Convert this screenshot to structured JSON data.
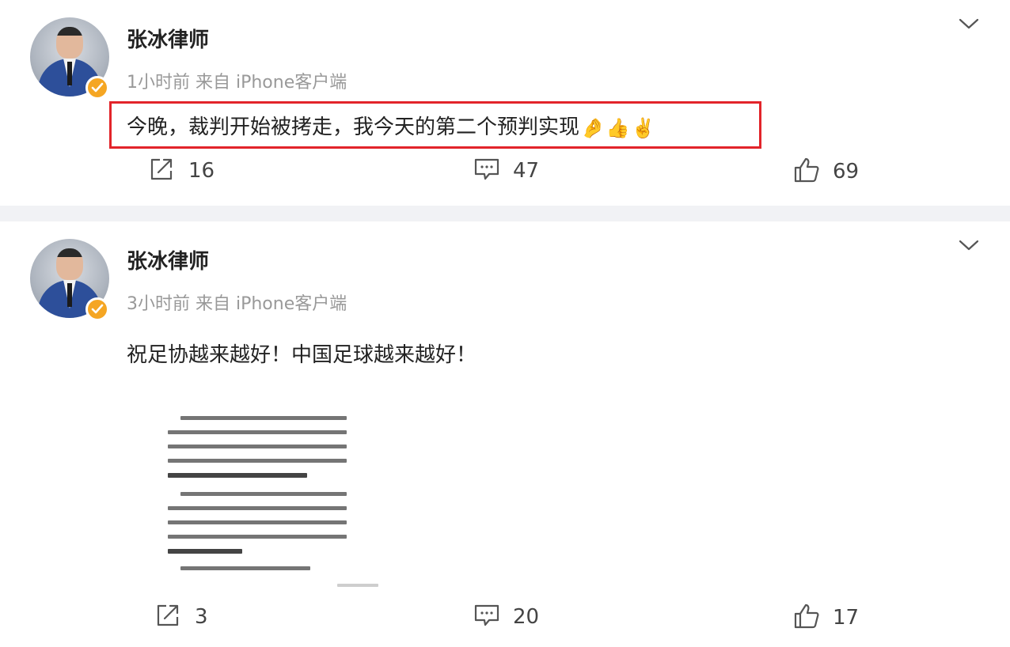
{
  "posts": [
    {
      "author": "张冰律师",
      "meta": "1小时前  来自 iPhone客户端",
      "text": "今晚，裁判开始被拷走，我今天的第二个预判实现",
      "emojis": [
        "🤌",
        "👍",
        "✌️"
      ],
      "highlighted": true,
      "stats": {
        "reposts": "16",
        "comments": "47",
        "likes": "69"
      }
    },
    {
      "author": "张冰律师",
      "meta": "3小时前  来自 iPhone客户端",
      "text": "祝足协越来越好！中国足球越来越好！",
      "has_image": true,
      "stats": {
        "reposts": "3",
        "comments": "20",
        "likes": "17"
      }
    }
  ],
  "icons": {
    "verified": "verified-badge-icon",
    "more": "chevron-down-icon",
    "repost": "repost-icon",
    "comment": "comment-icon",
    "like": "thumbs-up-icon"
  },
  "colors": {
    "verified": "#f5a623",
    "highlight_border": "#e2242a",
    "meta_text": "#999999",
    "feed_background": "#f1f2f5"
  }
}
